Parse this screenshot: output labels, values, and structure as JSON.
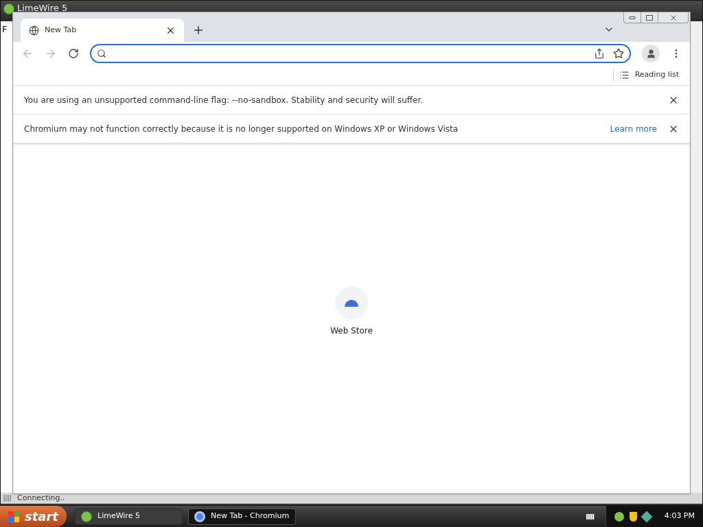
{
  "background_window": {
    "title": "LimeWire 5",
    "menu_first_letter": "F",
    "status": "Connecting.."
  },
  "browser": {
    "tabs": [
      {
        "label": "New Tab",
        "selected": true
      }
    ],
    "reading_list": "Reading list",
    "infobars": [
      {
        "message": "You are using an unsupported command-line flag: --no-sandbox. Stability and security will suffer."
      },
      {
        "message": "Chromium may not function correctly because it is no longer supported on Windows XP or Windows Vista",
        "link": "Learn more"
      }
    ],
    "shortcuts": [
      {
        "label": "Web Store"
      }
    ]
  },
  "taskbar": {
    "start": "start",
    "tasks": [
      {
        "label": "LimeWire 5",
        "selected": false,
        "kind": "limewire"
      },
      {
        "label": "New Tab - Chromium",
        "selected": true,
        "kind": "chromium"
      }
    ],
    "clock": "4:03 PM"
  }
}
